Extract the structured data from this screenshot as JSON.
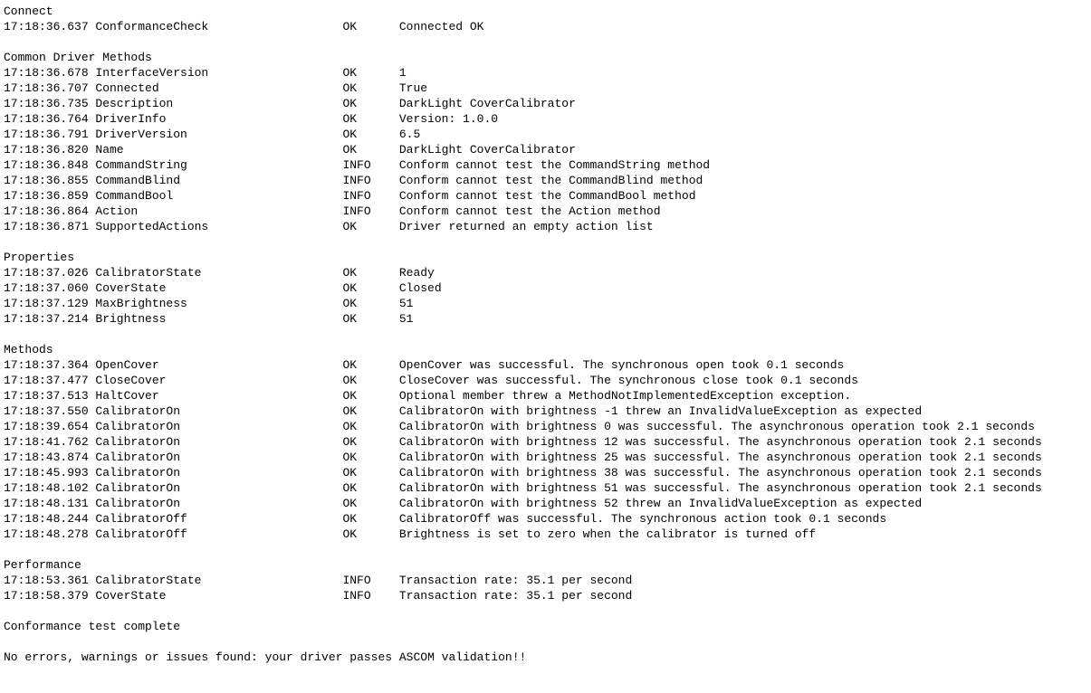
{
  "sections": [
    {
      "title": "Connect",
      "rows": [
        {
          "ts": "17:18:36.637",
          "name": "ConformanceCheck",
          "status": "OK",
          "msg": "Connected OK"
        }
      ]
    },
    {
      "title": "Common Driver Methods",
      "rows": [
        {
          "ts": "17:18:36.678",
          "name": "InterfaceVersion",
          "status": "OK",
          "msg": "1"
        },
        {
          "ts": "17:18:36.707",
          "name": "Connected",
          "status": "OK",
          "msg": "True"
        },
        {
          "ts": "17:18:36.735",
          "name": "Description",
          "status": "OK",
          "msg": "DarkLight CoverCalibrator"
        },
        {
          "ts": "17:18:36.764",
          "name": "DriverInfo",
          "status": "OK",
          "msg": "Version: 1.0.0"
        },
        {
          "ts": "17:18:36.791",
          "name": "DriverVersion",
          "status": "OK",
          "msg": "6.5"
        },
        {
          "ts": "17:18:36.820",
          "name": "Name",
          "status": "OK",
          "msg": "DarkLight CoverCalibrator"
        },
        {
          "ts": "17:18:36.848",
          "name": "CommandString",
          "status": "INFO",
          "msg": "Conform cannot test the CommandString method"
        },
        {
          "ts": "17:18:36.855",
          "name": "CommandBlind",
          "status": "INFO",
          "msg": "Conform cannot test the CommandBlind method"
        },
        {
          "ts": "17:18:36.859",
          "name": "CommandBool",
          "status": "INFO",
          "msg": "Conform cannot test the CommandBool method"
        },
        {
          "ts": "17:18:36.864",
          "name": "Action",
          "status": "INFO",
          "msg": "Conform cannot test the Action method"
        },
        {
          "ts": "17:18:36.871",
          "name": "SupportedActions",
          "status": "OK",
          "msg": "Driver returned an empty action list"
        }
      ]
    },
    {
      "title": "Properties",
      "rows": [
        {
          "ts": "17:18:37.026",
          "name": "CalibratorState",
          "status": "OK",
          "msg": "Ready"
        },
        {
          "ts": "17:18:37.060",
          "name": "CoverState",
          "status": "OK",
          "msg": "Closed"
        },
        {
          "ts": "17:18:37.129",
          "name": "MaxBrightness",
          "status": "OK",
          "msg": "51"
        },
        {
          "ts": "17:18:37.214",
          "name": "Brightness",
          "status": "OK",
          "msg": "51"
        }
      ]
    },
    {
      "title": "Methods",
      "rows": [
        {
          "ts": "17:18:37.364",
          "name": "OpenCover",
          "status": "OK",
          "msg": "OpenCover was successful. The synchronous open took 0.1 seconds"
        },
        {
          "ts": "17:18:37.477",
          "name": "CloseCover",
          "status": "OK",
          "msg": "CloseCover was successful. The synchronous close took 0.1 seconds"
        },
        {
          "ts": "17:18:37.513",
          "name": "HaltCover",
          "status": "OK",
          "msg": "Optional member threw a MethodNotImplementedException exception."
        },
        {
          "ts": "17:18:37.550",
          "name": "CalibratorOn",
          "status": "OK",
          "msg": "CalibratorOn with brightness -1 threw an InvalidValueException as expected"
        },
        {
          "ts": "17:18:39.654",
          "name": "CalibratorOn",
          "status": "OK",
          "msg": "CalibratorOn with brightness 0 was successful. The asynchronous operation took 2.1 seconds"
        },
        {
          "ts": "17:18:41.762",
          "name": "CalibratorOn",
          "status": "OK",
          "msg": "CalibratorOn with brightness 12 was successful. The asynchronous operation took 2.1 seconds"
        },
        {
          "ts": "17:18:43.874",
          "name": "CalibratorOn",
          "status": "OK",
          "msg": "CalibratorOn with brightness 25 was successful. The asynchronous operation took 2.1 seconds"
        },
        {
          "ts": "17:18:45.993",
          "name": "CalibratorOn",
          "status": "OK",
          "msg": "CalibratorOn with brightness 38 was successful. The asynchronous operation took 2.1 seconds"
        },
        {
          "ts": "17:18:48.102",
          "name": "CalibratorOn",
          "status": "OK",
          "msg": "CalibratorOn with brightness 51 was successful. The asynchronous operation took 2.1 seconds"
        },
        {
          "ts": "17:18:48.131",
          "name": "CalibratorOn",
          "status": "OK",
          "msg": "CalibratorOn with brightness 52 threw an InvalidValueException as expected"
        },
        {
          "ts": "17:18:48.244",
          "name": "CalibratorOff",
          "status": "OK",
          "msg": "CalibratorOff was successful. The synchronous action took 0.1 seconds"
        },
        {
          "ts": "17:18:48.278",
          "name": "CalibratorOff",
          "status": "OK",
          "msg": "Brightness is set to zero when the calibrator is turned off"
        }
      ]
    },
    {
      "title": "Performance",
      "rows": [
        {
          "ts": "17:18:53.361",
          "name": "CalibratorState",
          "status": "INFO",
          "msg": "Transaction rate: 35.1 per second"
        },
        {
          "ts": "17:18:58.379",
          "name": "CoverState",
          "status": "INFO",
          "msg": "Transaction rate: 35.1 per second"
        }
      ]
    }
  ],
  "footer": {
    "complete": "Conformance test complete",
    "result": "No errors, warnings or issues found: your driver passes ASCOM validation!!"
  }
}
